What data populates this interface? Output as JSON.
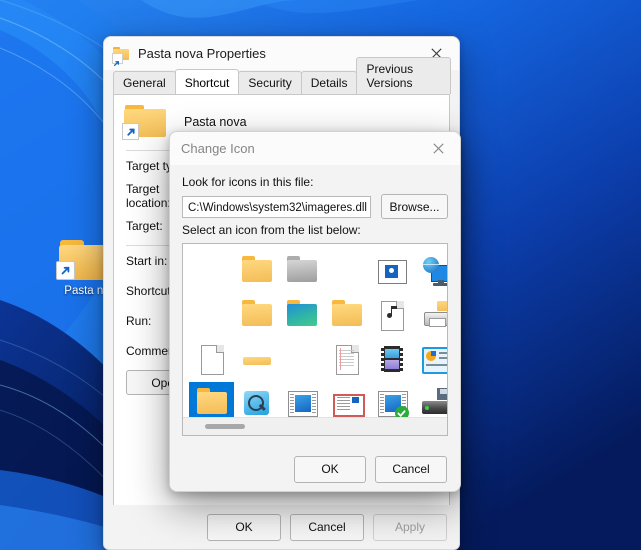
{
  "desktop": {
    "icon": {
      "label": "Pasta no",
      "icon_name": "folder-shortcut-icon"
    },
    "wallpaper_colors": [
      "#1a6fe8",
      "#1558d6",
      "#0d3fbe",
      "#072a8e",
      "#041a5c"
    ]
  },
  "properties_window": {
    "title": "Pasta nova Properties",
    "title_icon": "folder-shortcut-icon",
    "close_label": "✕",
    "tabs": [
      {
        "label": "General",
        "active": false
      },
      {
        "label": "Shortcut",
        "active": true
      },
      {
        "label": "Security",
        "active": false
      },
      {
        "label": "Details",
        "active": false
      },
      {
        "label": "Previous Versions",
        "active": false
      }
    ],
    "header_name": "Pasta nova",
    "fields": [
      {
        "label": "Target type:",
        "value": ""
      },
      {
        "label": "Target location:",
        "value": ""
      },
      {
        "label": "Target:",
        "value": ""
      },
      {
        "label": "Start in:",
        "value": ""
      },
      {
        "label": "Shortcut key:",
        "value": ""
      },
      {
        "label": "Run:",
        "value": ""
      },
      {
        "label": "Comment:",
        "value": ""
      }
    ],
    "open_button": "Open",
    "footer": {
      "ok": "OK",
      "cancel": "Cancel",
      "apply": "Apply",
      "apply_disabled": true
    }
  },
  "change_icon_dialog": {
    "title": "Change Icon",
    "close_label": "✕",
    "path_label": "Look for icons in this file:",
    "path_value": "C:\\Windows\\system32\\imageres.dll",
    "browse_button": "Browse...",
    "list_label": "Select an icon from the list below:",
    "selection_color": "#0078d7",
    "icons": [
      [
        {
          "name": "empty-cell",
          "type": "empty"
        },
        {
          "name": "folder-yellow-icon",
          "type": "folder-yellow"
        },
        {
          "name": "folder-gray-icon",
          "type": "folder-gray"
        },
        {
          "name": "empty-cell",
          "type": "empty"
        },
        {
          "name": "picture-window-icon",
          "type": "picture"
        },
        {
          "name": "network-globe-monitor-icon",
          "type": "network"
        },
        {
          "name": "drive-floppy-icon",
          "type": "drive-floppy"
        },
        {
          "name": "drive-green-icon",
          "type": "drive-partial"
        }
      ],
      [
        {
          "name": "empty-cell",
          "type": "empty"
        },
        {
          "name": "folder-yellow-icon",
          "type": "folder-yellow"
        },
        {
          "name": "folder-teal-icon",
          "type": "folder-teal"
        },
        {
          "name": "folder-yellow-light-icon",
          "type": "folder-yellow"
        },
        {
          "name": "music-file-icon",
          "type": "music-doc"
        },
        {
          "name": "printer-folder-icon",
          "type": "printer"
        },
        {
          "name": "disc-drive-icon",
          "type": "disc-drive"
        },
        {
          "name": "ram-stick-icon",
          "type": "ram"
        }
      ],
      [
        {
          "name": "blank-document-icon",
          "type": "doc-blank"
        },
        {
          "name": "folder-flat-icon",
          "type": "folder-flat"
        },
        {
          "name": "empty-cell",
          "type": "empty"
        },
        {
          "name": "text-document-icon",
          "type": "doc-lined"
        },
        {
          "name": "video-film-icon",
          "type": "film"
        },
        {
          "name": "presentation-screen-icon",
          "type": "presentation"
        },
        {
          "name": "drive-error-icon",
          "type": "drive-x"
        },
        {
          "name": "drive-green-icon",
          "type": "drive-partial"
        }
      ],
      [
        {
          "name": "folder-selected-icon",
          "type": "folder-yellow",
          "selected": true
        },
        {
          "name": "search-folder-icon",
          "type": "search-folder"
        },
        {
          "name": "window-icon",
          "type": "window"
        },
        {
          "name": "mail-envelope-icon",
          "type": "envelope"
        },
        {
          "name": "window-check-icon",
          "type": "window-check"
        },
        {
          "name": "drive-save-icon",
          "type": "drive-floppy2"
        },
        {
          "name": "drive-plain-icon",
          "type": "drive-plain"
        },
        {
          "name": "windows-logo-icon",
          "type": "win4"
        }
      ]
    ],
    "footer": {
      "ok": "OK",
      "cancel": "Cancel"
    }
  }
}
